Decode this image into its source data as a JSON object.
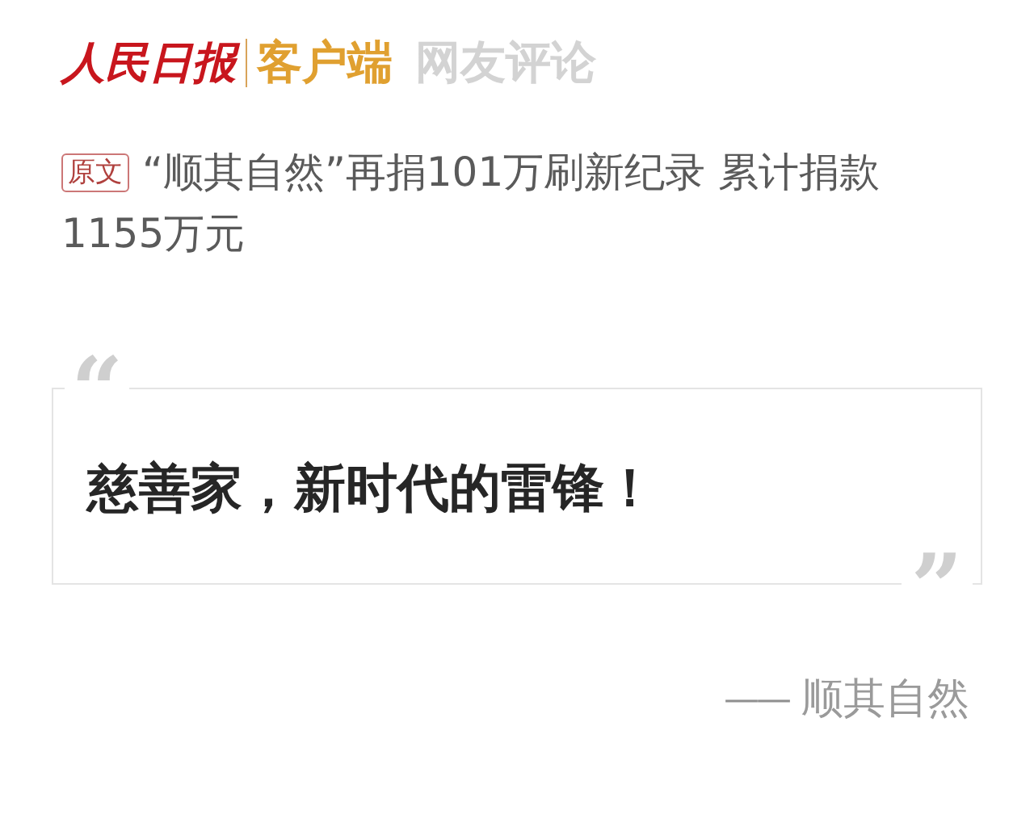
{
  "header": {
    "logo": "人民日报",
    "app_name": "客户端",
    "section": "网友评论"
  },
  "article": {
    "tag": "原文",
    "title": "“顺其自然”再捐101万刷新纪录 累计捐款1155万元"
  },
  "comment": {
    "open_quote": "“",
    "text": "慈善家，新时代的雷锋！",
    "close_quote": "”",
    "author_dash": "——",
    "author": "顺其自然"
  }
}
